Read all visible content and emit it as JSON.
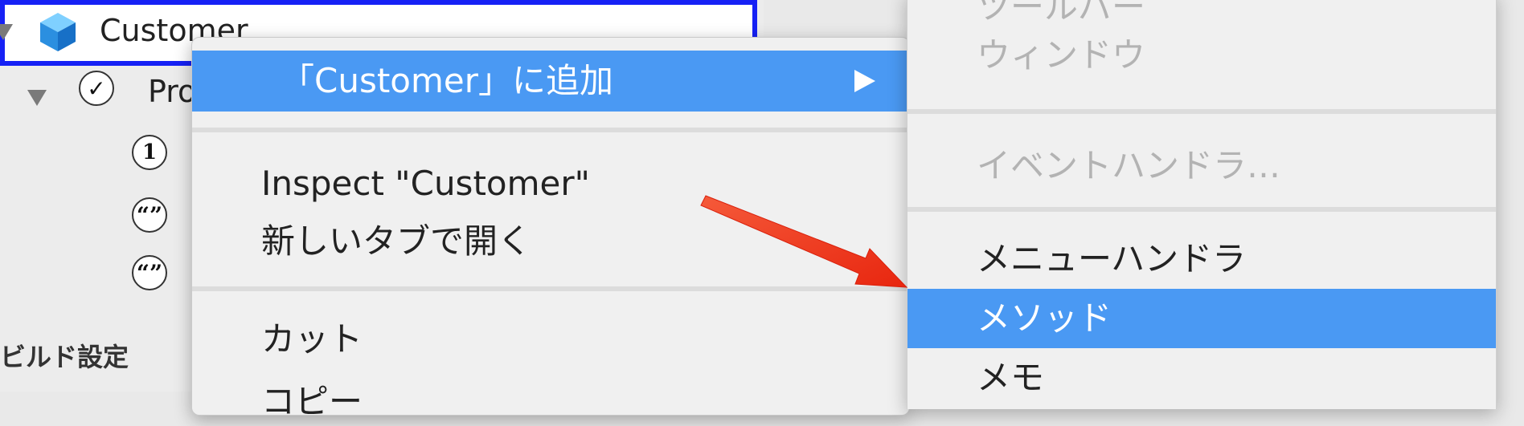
{
  "outline": {
    "root_item": {
      "label": "Customer",
      "icon": "cube-icon"
    },
    "child_item": {
      "label": "Pro",
      "icon": "checkmark-circle-icon"
    },
    "badges": [
      {
        "icon": "number-badge-icon",
        "glyph": "1"
      },
      {
        "icon": "quote-badge-icon",
        "glyph": "“”"
      },
      {
        "icon": "quote-badge-icon",
        "glyph": "“”"
      }
    ],
    "section_label": "ビルド設定"
  },
  "context_menu": {
    "add_to": "「Customer」に追加",
    "inspect": "Inspect \"Customer\"",
    "open_new_tab": "新しいタブで開く",
    "cut": "カット",
    "copy": "コピー"
  },
  "submenu": {
    "toolbar": "ツールバー",
    "window": "ウィンドウ",
    "event_handler": "イベントハンドラ…",
    "menu_handler": "メニューハンドラ",
    "method": "メソッド",
    "memo": "メモ"
  },
  "colors": {
    "highlight": "#4a99f3",
    "selection_border": "#1621f5",
    "annotation_arrow": "#f23a1f",
    "disabled_text": "#b3b3b3"
  }
}
